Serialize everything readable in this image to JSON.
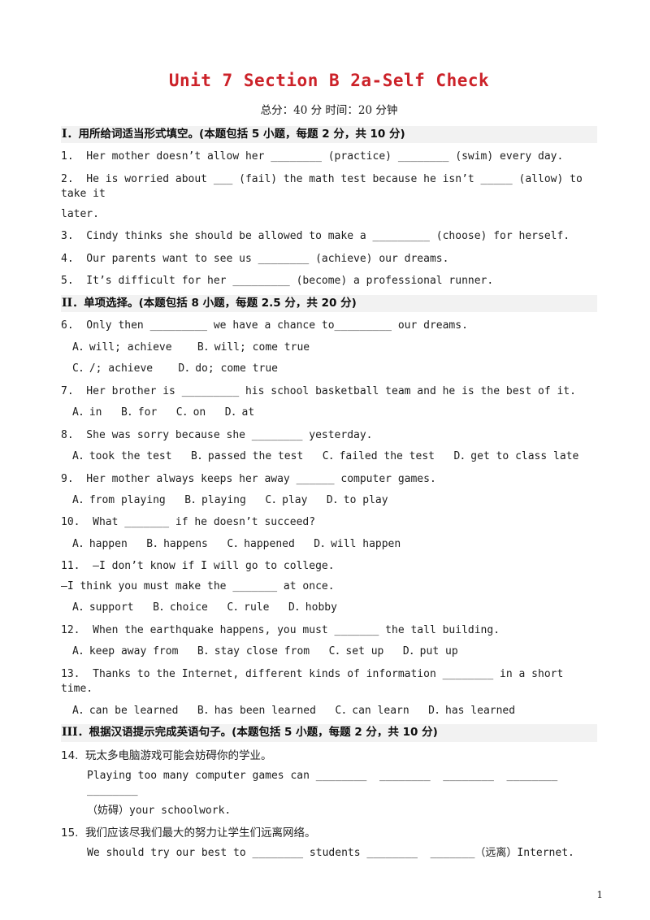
{
  "document": {
    "title": "Unit 7 Section B 2a-Self Check",
    "subtitle": "总分：40 分  时间：20 分钟",
    "page_number": "1",
    "title_color": "#cc2229"
  },
  "sections": [
    {
      "id": "section-1",
      "numeral": "I．",
      "heading": "用所给词适当形式填空。(本题包括 5 小题，每题 2 分，共 10 分)",
      "questions": [
        {
          "number": "1.",
          "text": "1.  Her mother doesn’t allow her ________ (practice) ________ (swim) every day."
        },
        {
          "number": "2.",
          "text": "2.  He is worried about ___ (fail) the math test because he isn’t _____ (allow) to take it",
          "continuation": "later."
        },
        {
          "number": "3.",
          "text": "3.  Cindy thinks she should be allowed to make a _________ (choose) for herself."
        },
        {
          "number": "4.",
          "text": "4.  Our parents want to see us ________ (achieve) our dreams."
        },
        {
          "number": "5.",
          "text": "5.  It’s difficult for her _________ (become) a professional runner."
        }
      ]
    },
    {
      "id": "section-2",
      "numeral": "II．",
      "heading": "单项选择。(本题包括 8 小题，每题 2.5 分，共 20 分)",
      "questions": [
        {
          "number": "6.",
          "text": "6.  Only then _________ we have a chance to_________ our dreams.",
          "options_line1": "A．will; achieve    B．will; come true",
          "options_line2": "C．/; achieve    D．do; come true"
        },
        {
          "number": "7.",
          "text": "7.  Her brother is _________ his school basketball team and he is the best of it.",
          "options_line1": "A．in   B．for   C．on   D．at"
        },
        {
          "number": "8.",
          "text": "8.  She was sorry because she ________ yesterday.",
          "options_line1": "A．took the test   B．passed the test   C．failed the test   D．get to class late"
        },
        {
          "number": "9.",
          "text": "9.  Her mother always keeps her away ______ computer games.",
          "options_line1": "A．from playing   B．playing   C．play   D．to play"
        },
        {
          "number": "10.",
          "text": "10.  What _______ if he doesn’t succeed?",
          "options_line1": "A．happen   B．happens   C．happened   D．will happen"
        },
        {
          "number": "11.",
          "text": "11.  —I don’t know if I will go to college.",
          "continuation": "—I think you must make the _______ at once.",
          "options_line1": "A．support   B．choice   C．rule   D．hobby"
        },
        {
          "number": "12.",
          "text": "12.  When the earthquake happens, you must _______ the tall building.",
          "options_line1": "A．keep away from   B．stay close from   C．set up   D．put up"
        },
        {
          "number": "13.",
          "text": "13.  Thanks to the Internet, different kinds of information ________ in a short time.",
          "options_line1": "A．can be learned   B．has been learned   C．can learn   D．has learned"
        }
      ]
    },
    {
      "id": "section-3",
      "numeral": "III．",
      "heading": "根据汉语提示完成英语句子。(本题包括 5 小题，每题 2 分，共 10 分)",
      "questions": [
        {
          "number": "14.",
          "prompt_cn": "14.  玩太多电脑游戏可能会妨碍你的学业。",
          "answer_line1": "Playing too many computer games can ________  ________  ________  ________  ________",
          "answer_line2": "（妨碍）your schoolwork."
        },
        {
          "number": "15.",
          "prompt_cn": "15.  我们应该尽我们最大的努力让学生们远离网络。",
          "answer_line1": "We should try our best to ________ students ________  _______（远离）Internet."
        }
      ]
    }
  ]
}
